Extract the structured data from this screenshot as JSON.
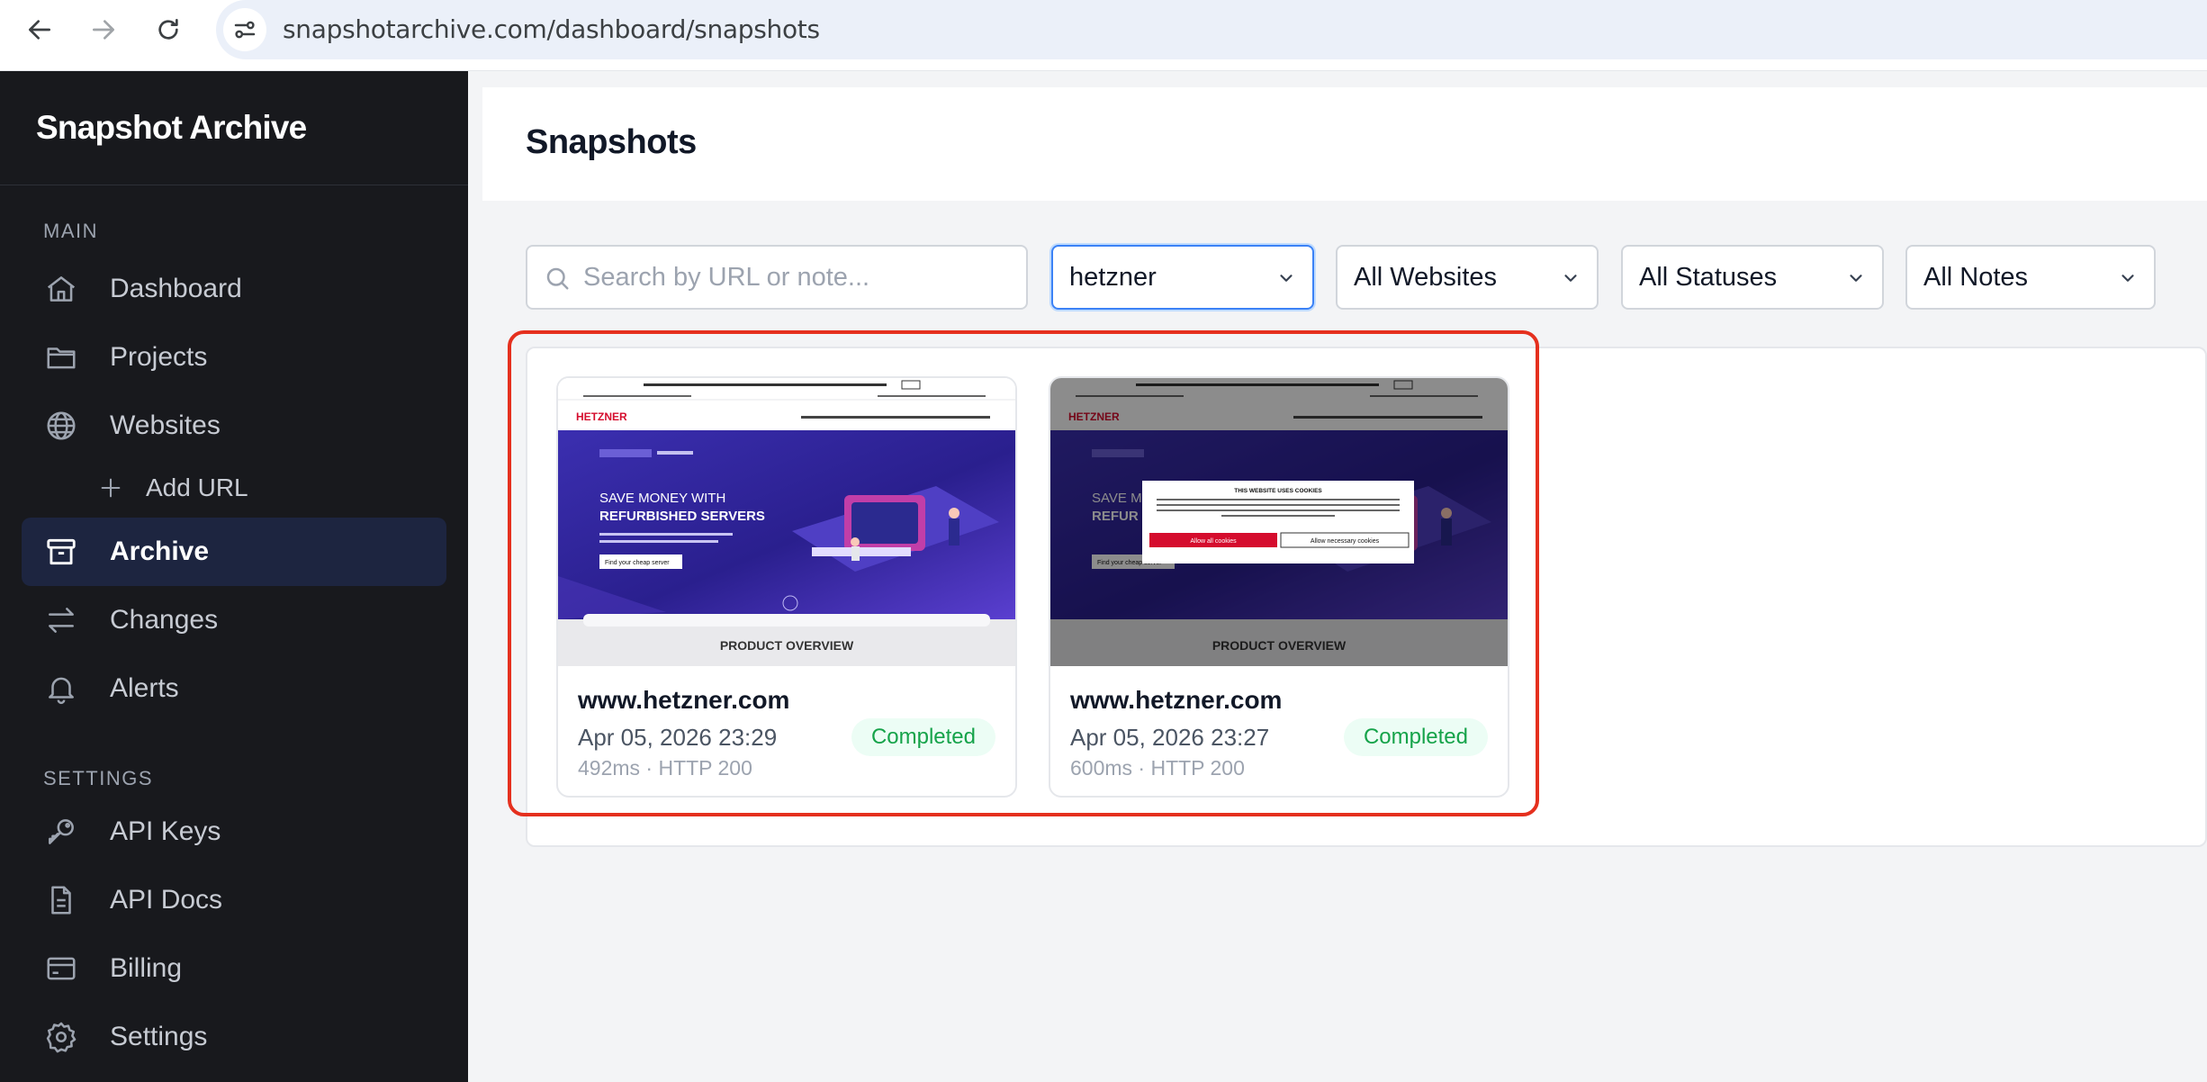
{
  "browser": {
    "url": "snapshotarchive.com/dashboard/snapshots"
  },
  "sidebar": {
    "brand": "Snapshot Archive",
    "sections": {
      "main": "MAIN",
      "settings": "SETTINGS"
    },
    "items": [
      {
        "label": "Dashboard",
        "icon": "home-icon"
      },
      {
        "label": "Projects",
        "icon": "folder-icon"
      },
      {
        "label": "Websites",
        "icon": "globe-icon"
      },
      {
        "label": "Add URL",
        "icon": "plus-icon"
      },
      {
        "label": "Archive",
        "icon": "archive-icon",
        "active": true
      },
      {
        "label": "Changes",
        "icon": "arrows-exchange-icon"
      },
      {
        "label": "Alerts",
        "icon": "bell-icon"
      },
      {
        "label": "API Keys",
        "icon": "key-icon"
      },
      {
        "label": "API Docs",
        "icon": "document-icon"
      },
      {
        "label": "Billing",
        "icon": "credit-card-icon"
      },
      {
        "label": "Settings",
        "icon": "gear-icon"
      }
    ]
  },
  "main": {
    "title": "Snapshots",
    "search": {
      "placeholder": "Search by URL or note...",
      "value": ""
    },
    "filters": {
      "project": "hetzner",
      "website": "All Websites",
      "status": "All Statuses",
      "notes": "All Notes"
    },
    "snapshots": [
      {
        "domain": "www.hetzner.com",
        "date": "Apr 05, 2026 23:29",
        "meta": "492ms · HTTP 200",
        "status": "Completed",
        "thumb": {
          "brand": "HETZNER",
          "headline1": "SAVE MONEY WITH",
          "headline2": "REFURBISHED SERVERS",
          "cta": "Find your cheap server",
          "section": "PRODUCT OVERVIEW",
          "cookie_banner": false
        }
      },
      {
        "domain": "www.hetzner.com",
        "date": "Apr 05, 2026 23:27",
        "meta": "600ms · HTTP 200",
        "status": "Completed",
        "thumb": {
          "brand": "HETZNER",
          "headline1": "SAVE M",
          "headline2": "REFUR",
          "cta": "Find your cheap server",
          "section": "PRODUCT OVERVIEW",
          "cookie_banner": true,
          "cookie_title": "THIS WEBSITE USES COOKIES",
          "cookie_accept": "Allow all cookies",
          "cookie_necessary": "Allow necessary cookies"
        }
      }
    ]
  },
  "colors": {
    "sidebar_bg": "#18191d",
    "active_item_bg": "#1d2540",
    "highlight_border": "#e5301e",
    "status_completed": "#16a34a",
    "brand_red": "#d50c2d"
  }
}
